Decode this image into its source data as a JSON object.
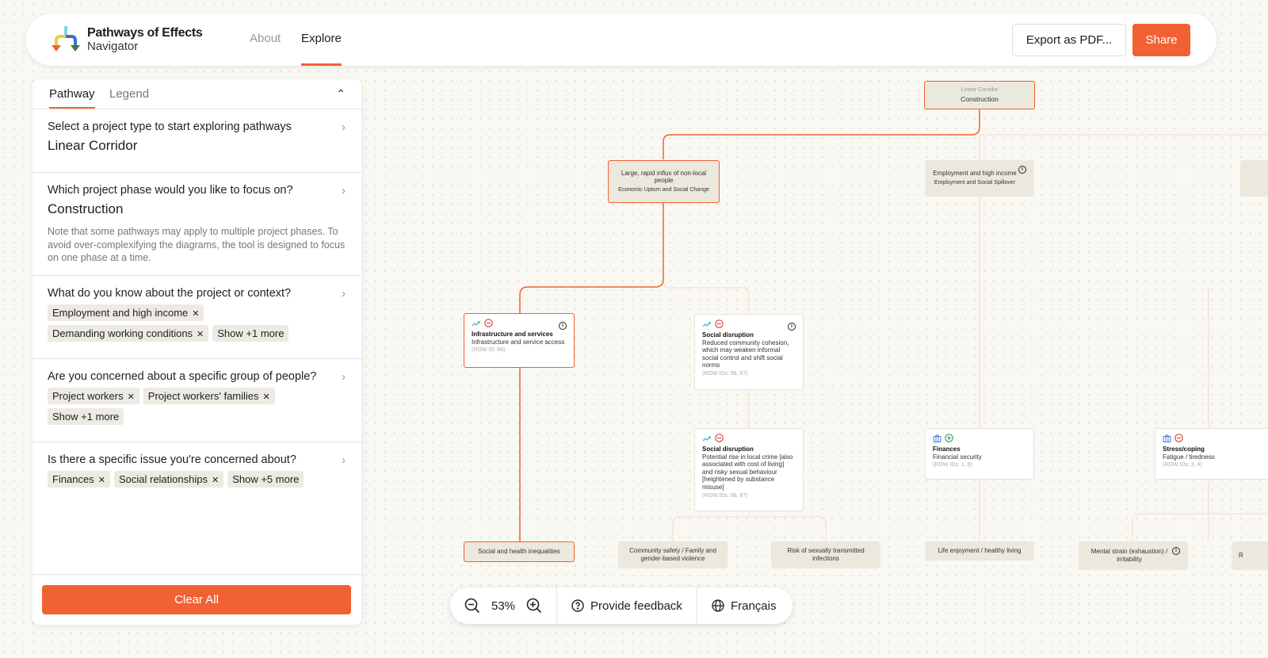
{
  "header": {
    "brand_line1": "Pathways of Effects",
    "brand_line2": "Navigator",
    "nav": [
      "About",
      "Explore"
    ],
    "active_nav": "Explore",
    "export_label": "Export as PDF...",
    "share_label": "Share",
    "accent": "#f26133"
  },
  "panel": {
    "tabs": [
      "Pathway",
      "Legend"
    ],
    "sections": [
      {
        "question": "Select a project type to start exploring pathways",
        "answer": "Linear Corridor"
      },
      {
        "question": "Which project phase would you like to focus on?",
        "answer": "Construction",
        "note": "Note that some pathways may apply to multiple project phases. To avoid over-complexifying the diagrams, the tool is designed to focus on one phase at a time."
      },
      {
        "question": "What do you know about the project or context?",
        "chips": [
          "Employment and high income",
          "Demanding working conditions"
        ],
        "more": "Show +1 more"
      },
      {
        "question": "Are you concerned about a specific group of people?",
        "chips": [
          "Project workers",
          "Project workers' families"
        ],
        "more": "Show +1 more"
      },
      {
        "question": "Is there a specific issue you're concerned about?",
        "chips": [
          "Finances",
          "Social relationships"
        ],
        "more": "Show +5 more"
      }
    ],
    "clear_label": "Clear All"
  },
  "diagram": {
    "root": {
      "label": "Linear Corridor",
      "title": "Construction"
    },
    "level1": [
      {
        "title": "Large, rapid influx of non-local people",
        "sub": "Economic Upturn and Social Change"
      },
      {
        "title": "Employment and high income",
        "sub": "Employment and Social Spillover"
      }
    ],
    "effects": [
      {
        "title": "Infrastructure and services",
        "desc": "Infrastructure and service access",
        "rows": "(ROW ID: 68)",
        "icon": "trend-up-icon",
        "sign": "negative"
      },
      {
        "title": "Social disruption",
        "desc": "Reduced community cohesion, which may weaken informal social control and shift social norms",
        "rows": "(ROW IDs: 66, 67)",
        "icon": "trend-up-icon",
        "sign": "negative"
      },
      {
        "title": "Social disruption",
        "desc": "Potential rise in local crime [also associated with cost of living] and risky sexual behaviour [heightened by substance misuse]",
        "rows": "(ROW IDs: 66, 67)",
        "icon": "trend-up-icon",
        "sign": "negative"
      },
      {
        "title": "Finances",
        "desc": "Financial security",
        "rows": "(ROW IDs: 1, 9)",
        "icon": "briefcase-icon",
        "sign": "positive"
      },
      {
        "title": "Stress/coping",
        "desc": "Fatigue / tiredness",
        "rows": "(ROW IDs: 3, 4)",
        "icon": "briefcase-icon",
        "sign": "negative"
      }
    ],
    "outcomes": [
      "Social and health inequalities",
      "Community safety / Family and gender-based violence",
      "Risk of sexually transmitted infections",
      "Life enjoyment / healthy living",
      "Mental strain (exhaustion) / irritability",
      "R"
    ]
  },
  "zoombar": {
    "zoom": "53%",
    "feedback": "Provide feedback",
    "language": "Français"
  }
}
